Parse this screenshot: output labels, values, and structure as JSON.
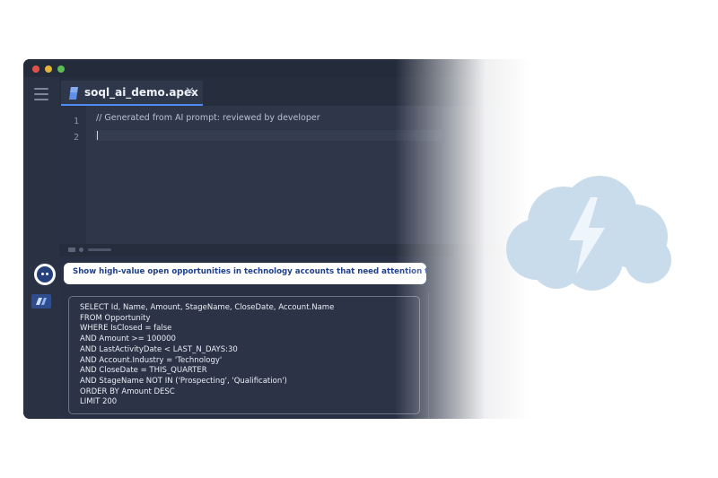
{
  "window": {
    "tab": {
      "label": "soql_ai_demo.apex",
      "close_glyph": "✕"
    },
    "line_numbers": [
      "1",
      "2"
    ],
    "code": {
      "comment_line": "// Generated from AI prompt: reviewed by developer"
    }
  },
  "assistant": {
    "prompt": "Show high-value open opportunities in technology accounts that need attention this quarter."
  },
  "query": {
    "lines": [
      "SELECT Id, Name, Amount, StageName, CloseDate, Account.Name",
      "FROM Opportunity",
      "WHERE IsClosed = false",
      "AND Amount >= 100000",
      "AND LastActivityDate < LAST_N_DAYS:30",
      "AND Account.Industry = 'Technology'",
      "AND CloseDate = THIS_QUARTER",
      "AND StageName NOT IN ('Prospecting', 'Qualification')",
      "ORDER BY Amount DESC",
      "LIMIT 200"
    ]
  },
  "icons": {
    "menu": "hamburger-menu-icon",
    "file": "apex-file-icon",
    "close": "close-icon",
    "assistant": "bot-avatar-icon",
    "panel_badge": "bolt-badge-icon",
    "brand": "cloud-lightning-logo"
  },
  "colors": {
    "window_bg": "#2b3346",
    "accent": "#4e8bf5",
    "prompt_text": "#1f3f8a",
    "cloud": "#c9dcec"
  }
}
